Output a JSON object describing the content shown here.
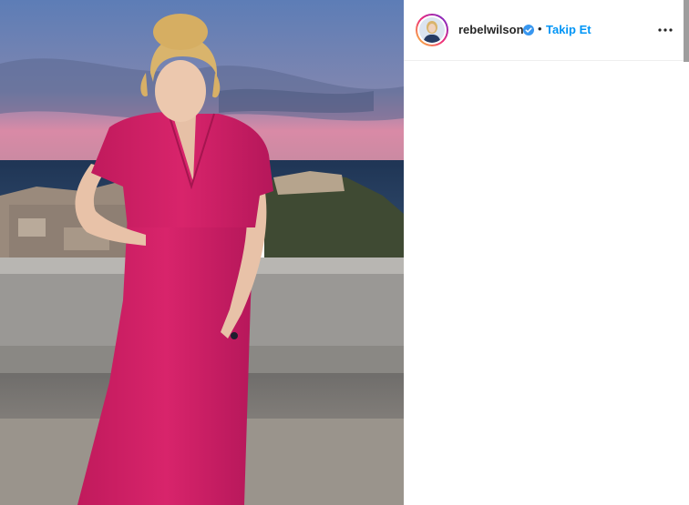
{
  "post": {
    "image_alt": "Woman in a long magenta dress standing on a terrace overlooking a coastal city at dusk",
    "colors": {
      "dress": "#d21f66",
      "sky_top": "#5d7db6",
      "sky_pink": "#d98aa6",
      "floor": "#8f8880"
    }
  },
  "header": {
    "username": "rebelwilson",
    "separator": "•",
    "follow_label": "Takip Et",
    "verified_icon": "verified-badge-icon",
    "more_icon": "more-options-icon"
  },
  "colors": {
    "accent": "#0095f6",
    "text": "#262626"
  }
}
